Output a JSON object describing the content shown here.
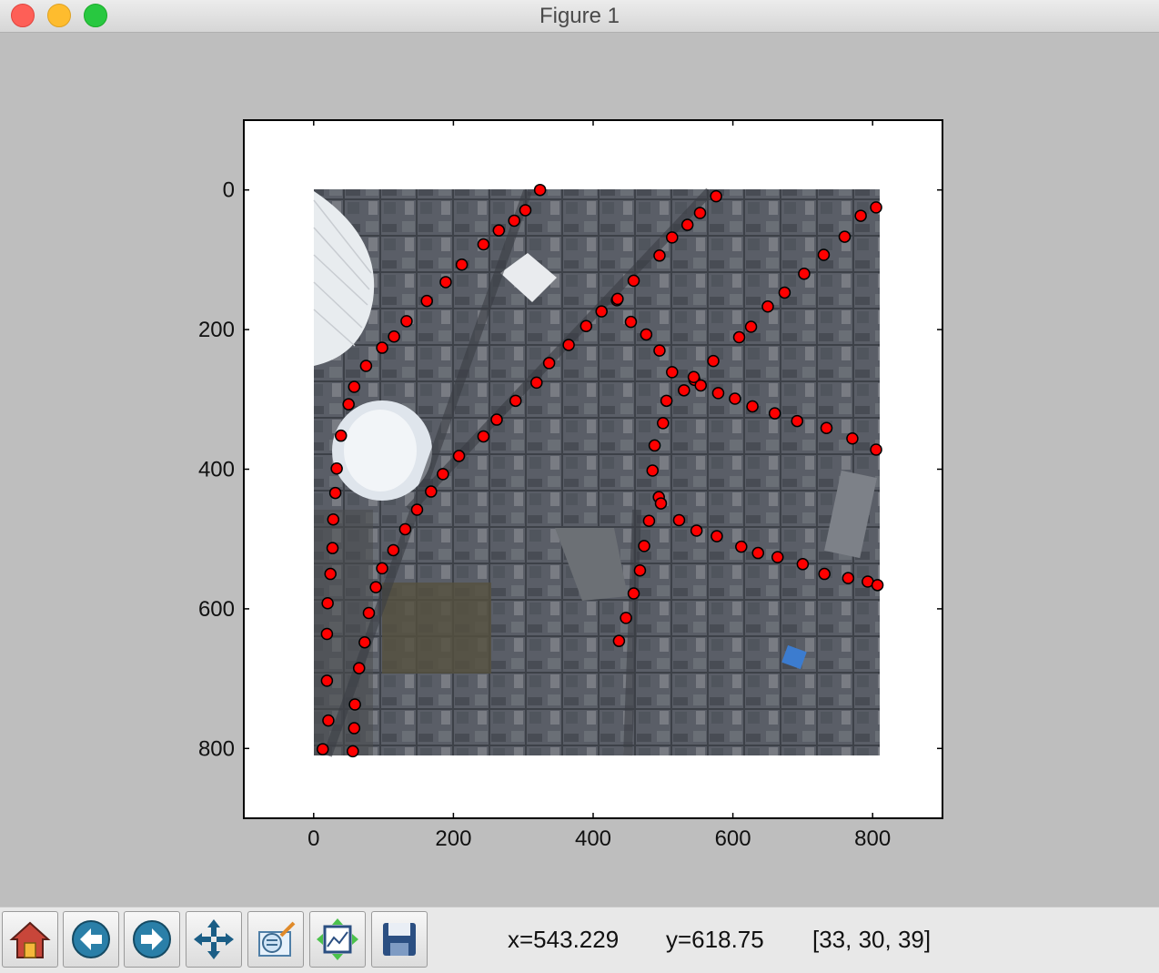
{
  "window": {
    "title": "Figure 1"
  },
  "toolbar": {
    "buttons": [
      {
        "name": "home-button",
        "icon": "home-icon"
      },
      {
        "name": "back-button",
        "icon": "back-arrow-icon"
      },
      {
        "name": "forward-button",
        "icon": "forward-arrow-icon"
      },
      {
        "name": "pan-button",
        "icon": "move-icon"
      },
      {
        "name": "zoom-button",
        "icon": "zoom-rect-icon"
      },
      {
        "name": "subplots-button",
        "icon": "subplots-icon"
      },
      {
        "name": "save-button",
        "icon": "floppy-disk-icon"
      }
    ]
  },
  "status": {
    "x": "x=543.229",
    "y": "y=618.75",
    "pixel": "[33, 30, 39]"
  },
  "chart_data": {
    "type": "scatter",
    "title": "",
    "xlabel": "",
    "ylabel": "",
    "xlim": [
      -100,
      900
    ],
    "ylim": [
      900,
      -100
    ],
    "xticks": [
      0,
      200,
      400,
      600,
      800
    ],
    "yticks": [
      0,
      200,
      400,
      600,
      800
    ],
    "tick_labels": {
      "x": [
        "0",
        "200",
        "400",
        "600",
        "800"
      ],
      "y": [
        "0",
        "200",
        "400",
        "600",
        "800"
      ]
    },
    "background_image": {
      "extent": [
        0,
        810,
        810,
        0
      ],
      "description_color": "#5a5e66"
    },
    "marker": {
      "shape": "circle",
      "face": "#ff0000",
      "edge": "#000000"
    },
    "series": [
      {
        "values": [
          [
            324,
            0
          ],
          [
            303,
            29
          ],
          [
            287,
            44
          ],
          [
            265,
            58
          ],
          [
            243,
            78
          ],
          [
            212,
            107
          ],
          [
            189,
            132
          ],
          [
            162,
            159
          ],
          [
            133,
            188
          ],
          [
            115,
            210
          ],
          [
            98,
            226
          ],
          [
            75,
            252
          ],
          [
            58,
            282
          ],
          [
            50,
            307
          ],
          [
            39,
            352
          ],
          [
            33,
            399
          ],
          [
            31,
            434
          ],
          [
            28,
            472
          ],
          [
            27,
            513
          ],
          [
            24,
            550
          ],
          [
            20,
            592
          ],
          [
            19,
            636
          ],
          [
            19,
            703
          ],
          [
            21,
            760
          ],
          [
            13,
            801
          ]
        ]
      },
      {
        "values": [
          [
            56,
            804
          ],
          [
            58,
            771
          ],
          [
            59,
            737
          ],
          [
            65,
            685
          ],
          [
            73,
            648
          ],
          [
            79,
            606
          ],
          [
            89,
            569
          ],
          [
            98,
            542
          ],
          [
            114,
            516
          ],
          [
            131,
            486
          ],
          [
            148,
            458
          ],
          [
            168,
            432
          ],
          [
            185,
            407
          ],
          [
            208,
            381
          ],
          [
            243,
            353
          ],
          [
            262,
            329
          ],
          [
            289,
            302
          ],
          [
            319,
            276
          ],
          [
            337,
            248
          ],
          [
            365,
            222
          ],
          [
            390,
            195
          ],
          [
            412,
            174
          ],
          [
            434,
            158
          ],
          [
            435,
            156
          ],
          [
            458,
            130
          ],
          [
            495,
            94
          ],
          [
            513,
            68
          ],
          [
            535,
            50
          ],
          [
            553,
            33
          ],
          [
            576,
            9
          ]
        ]
      },
      {
        "values": [
          [
            805,
            25
          ],
          [
            783,
            37
          ],
          [
            760,
            67
          ],
          [
            730,
            93
          ],
          [
            702,
            120
          ],
          [
            674,
            147
          ],
          [
            650,
            167
          ],
          [
            626,
            196
          ],
          [
            609,
            211
          ],
          [
            572,
            245
          ],
          [
            545,
            272
          ],
          [
            530,
            287
          ],
          [
            505,
            302
          ],
          [
            500,
            334
          ],
          [
            488,
            366
          ],
          [
            485,
            402
          ],
          [
            494,
            440
          ],
          [
            497,
            449
          ],
          [
            480,
            474
          ],
          [
            473,
            510
          ],
          [
            467,
            545
          ],
          [
            458,
            578
          ],
          [
            447,
            613
          ],
          [
            437,
            646
          ]
        ]
      },
      {
        "values": [
          [
            454,
            189
          ],
          [
            476,
            207
          ],
          [
            495,
            230
          ],
          [
            513,
            261
          ],
          [
            544,
            268
          ],
          [
            554,
            280
          ],
          [
            579,
            291
          ],
          [
            603,
            299
          ],
          [
            628,
            310
          ],
          [
            660,
            320
          ],
          [
            692,
            331
          ],
          [
            734,
            341
          ],
          [
            771,
            356
          ],
          [
            805,
            372
          ]
        ]
      },
      {
        "values": [
          [
            523,
            473
          ],
          [
            548,
            488
          ],
          [
            577,
            496
          ],
          [
            612,
            511
          ],
          [
            636,
            520
          ],
          [
            664,
            526
          ],
          [
            700,
            536
          ],
          [
            731,
            550
          ],
          [
            765,
            556
          ],
          [
            793,
            561
          ],
          [
            807,
            566
          ]
        ]
      }
    ]
  }
}
